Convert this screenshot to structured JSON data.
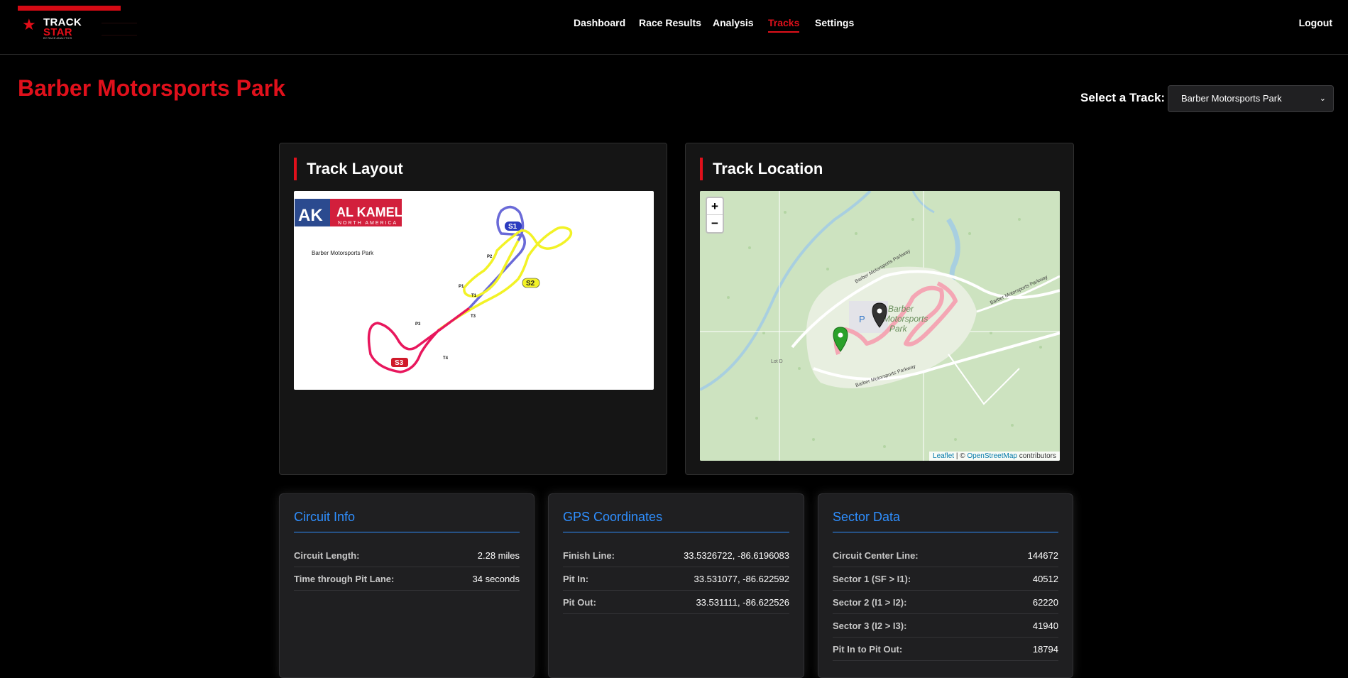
{
  "brand": {
    "line1": "TRACK",
    "line2": "STAR",
    "tagline": "BY RACE ANALYTICS"
  },
  "nav": {
    "items": [
      {
        "label": "Dashboard",
        "active": false
      },
      {
        "label": "Race Results",
        "active": false
      },
      {
        "label": "Analysis",
        "active": false
      },
      {
        "label": "Tracks",
        "active": true
      },
      {
        "label": "Settings",
        "active": false
      }
    ],
    "logout": "Logout"
  },
  "page": {
    "title": "Barber Motorsports Park",
    "select_label": "Select a Track:",
    "selected_track": "Barber Motorsports Park"
  },
  "track_layout": {
    "heading": "Track Layout",
    "logo_ak": "AK",
    "logo_name": "AL KAMEL",
    "logo_sub": "NORTH AMERICA",
    "caption": "Barber Motorsports Park",
    "labels": {
      "s1": "S1",
      "s2": "S2",
      "s3": "S3",
      "p1": "P1",
      "p2": "P2",
      "p3": "P3",
      "t1": "T1",
      "t3": "T3",
      "t4": "T4"
    }
  },
  "track_location": {
    "heading": "Track Location",
    "zoom_in": "+",
    "zoom_out": "−",
    "parking_label": "P",
    "map_label_1": "Barber",
    "map_label_2": "Motorsports",
    "map_label_3": "Park",
    "road_label": "Barber Motorsports Parkway",
    "lot_label": "Lot D",
    "attribution_leaflet": "Leaflet",
    "attribution_sep": "| ©",
    "attribution_osm": "OpenStreetMap",
    "attribution_end": "contributors"
  },
  "circuit_info": {
    "heading": "Circuit Info",
    "rows": [
      {
        "label": "Circuit Length:",
        "value": "2.28 miles"
      },
      {
        "label": "Time through Pit Lane:",
        "value": "34 seconds"
      }
    ]
  },
  "gps": {
    "heading": "GPS Coordinates",
    "rows": [
      {
        "label": "Finish Line:",
        "value": "33.5326722, -86.6196083"
      },
      {
        "label": "Pit In:",
        "value": "33.531077, -86.622592"
      },
      {
        "label": "Pit Out:",
        "value": "33.531111, -86.622526"
      }
    ]
  },
  "sectors": {
    "heading": "Sector Data",
    "rows": [
      {
        "label": "Circuit Center Line:",
        "value": "144672"
      },
      {
        "label": "Sector 1 (SF > I1):",
        "value": "40512"
      },
      {
        "label": "Sector 2 (I1 > I2):",
        "value": "62220"
      },
      {
        "label": "Sector 3 (I2 > I3):",
        "value": "41940"
      },
      {
        "label": "Pit In to Pit Out:",
        "value": "18794"
      }
    ]
  },
  "colors": {
    "accent_red": "#e0101b",
    "accent_blue": "#2f8fff",
    "sector1": "#6a6ad8",
    "sector2": "#f2f226",
    "sector3": "#e8175d"
  }
}
